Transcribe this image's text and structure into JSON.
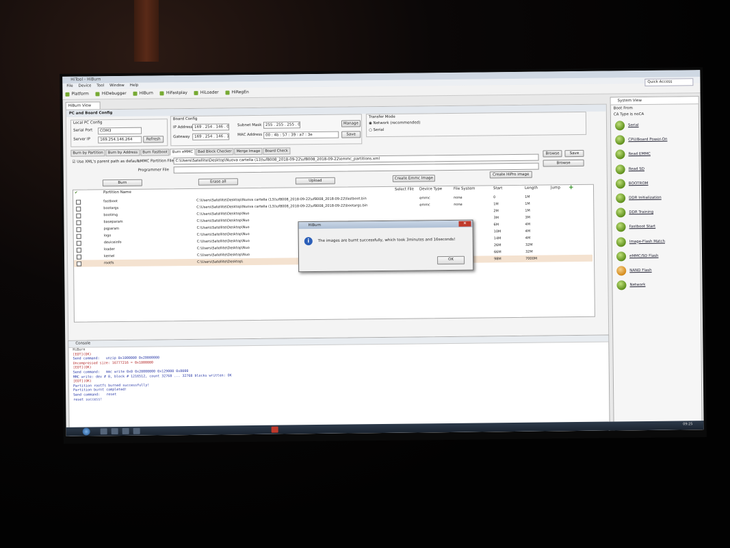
{
  "window": {
    "title": "HiTool - HiBurn"
  },
  "menu": [
    "File",
    "Device",
    "Tool",
    "Window",
    "Help"
  ],
  "toolbar": [
    "Platform",
    "HiDebugger",
    "HiBurn",
    "HiFastplay",
    "HiLoader",
    "HiRegEn"
  ],
  "quick_access": "Quick Access",
  "view_tab": "HiBurn View",
  "pc_board": {
    "section": "PC and Board Config",
    "local_pc": "Local PC Config",
    "serial_port_label": "Serial Port",
    "serial_port_value": "COM3",
    "server_ip_label": "Server IP",
    "server_ip_value": "169.254.146.264",
    "refresh": "Refresh",
    "board_config": "Board Config",
    "ip_label": "IP Address",
    "ip_value": "169 . 254 . 146 . 0",
    "gateway_label": "Gateway",
    "gateway_value": "169 . 254 . 146 . 1",
    "subnet_label": "Subnet Mask",
    "subnet_value": "255 . 255 . 255 . 0",
    "mac_label": "MAC Address",
    "mac_value": "00 : 4b : 57 : 39 : a7 : 3e",
    "manage": "Manage",
    "save": "Save",
    "transfer_mode": "Transfer Mode",
    "network": "Network (recommended)",
    "serial": "Serial"
  },
  "tabs": [
    "Burn by Partition",
    "Burn by Address",
    "Burn Fastboot",
    "Burn eMMC",
    "Bad Block Checker",
    "Merge Image",
    "Board Check"
  ],
  "burn": {
    "use_xml": "Use XML's parent path as default",
    "partition_file_label": "eMMC Partition File",
    "partition_file_value": "C:\\Users\\Satellite\\Desktop\\Nuova cartella (13)\\uf8008_2018-09-22\\uf8008_2018-09-22\\emmc_partitions.xml",
    "programmer_label": "Programmer File",
    "browse": "Browse",
    "save": "Save",
    "browse2": "Browse",
    "burn": "Burn",
    "erase": "Erase all",
    "upload": "Upload",
    "create_emmc": "Create Emmc Image",
    "create_hipro": "Create HiPro image"
  },
  "table": {
    "headers": [
      "Partition Name",
      "Select File",
      "Device Type",
      "File System",
      "Start",
      "Length",
      "Jump"
    ],
    "rows": [
      {
        "name": "fastboot",
        "file": "C:\\Users\\Satellite\\Desktop\\Nuova cartella (13)\\uf8008_2018-09-22\\uf8008_2018-09-22\\fastboot.bin",
        "dev": "emmc",
        "fs": "none",
        "start": "0",
        "len": "1M"
      },
      {
        "name": "bootargs",
        "file": "C:\\Users\\Satellite\\Desktop\\Nuova cartella (13)\\uf8008_2018-09-22\\uf8008_2018-09-22\\bootargs.bin",
        "dev": "emmc",
        "fs": "none",
        "start": "1M",
        "len": "1M"
      },
      {
        "name": "bootimg",
        "file": "C:\\Users\\Satellite\\Desktop\\Nuo",
        "dev": "",
        "fs": "",
        "start": "2M",
        "len": "1M"
      },
      {
        "name": "baseparam",
        "file": "C:\\Users\\Satellite\\Desktop\\Nuo",
        "dev": "",
        "fs": "",
        "start": "3M",
        "len": "3M"
      },
      {
        "name": "pqparam",
        "file": "C:\\Users\\Satellite\\Desktop\\Nuo",
        "dev": "",
        "fs": "",
        "start": "6M",
        "len": "4M"
      },
      {
        "name": "logo",
        "file": "C:\\Users\\Satellite\\Desktop\\Nuo",
        "dev": "",
        "fs": "",
        "start": "10M",
        "len": "4M"
      },
      {
        "name": "deviceinfo",
        "file": "C:\\Users\\Satellite\\Desktop\\Nuo",
        "dev": "",
        "fs": "",
        "start": "14M",
        "len": "4M"
      },
      {
        "name": "loader",
        "file": "C:\\Users\\Satellite\\Desktop\\Nuo",
        "dev": "",
        "fs": "",
        "start": "26M",
        "len": "32M"
      },
      {
        "name": "kernel",
        "file": "C:\\Users\\Satellite\\Desktop\\Nuo",
        "dev": "",
        "fs": "",
        "start": "66M",
        "len": "32M"
      },
      {
        "name": "rootfs",
        "file": "C:\\Users\\Satellite\\Desktop\\",
        "dev": "",
        "fs": "",
        "start": "98M",
        "len": "7000M"
      }
    ]
  },
  "dialog": {
    "title": "HiBurn",
    "message": "The images are burnt successfully, which took 3minutes and 16seconds!",
    "ok": "OK"
  },
  "console": {
    "title": "Console",
    "sub": "HiBurn",
    "lines": [
      {
        "t": "[EOT](OK)",
        "c": "red"
      },
      {
        "t": "Send command:   unzip 0x1000000 0x20000000",
        "c": "blue"
      },
      {
        "t": "Uncompressed size: 16777216 = 0x1000000",
        "c": "red"
      },
      {
        "t": "[EOT](OK)",
        "c": "red"
      },
      {
        "t": "",
        "c": "dark"
      },
      {
        "t": "Send command:   mmc write 0x0 0x20000000 0x129000 0x8000",
        "c": "blue"
      },
      {
        "t": "",
        "c": "dark"
      },
      {
        "t": "MMC write: dev # 0, block # 1216512, count 32768 ... 32768 blocks written: OK",
        "c": "blue"
      },
      {
        "t": "[EOT](OK)",
        "c": "red"
      },
      {
        "t": "Partition rootfs burned successfully!",
        "c": "blue"
      },
      {
        "t": "Partition burnt completed!",
        "c": "blue"
      },
      {
        "t": "",
        "c": "dark"
      },
      {
        "t": "Send command:   reset",
        "c": "blue"
      },
      {
        "t": "reset success!",
        "c": "blue"
      }
    ]
  },
  "system_view": {
    "title": "System View",
    "boot_from": "Boot From",
    "ca_type": "CA Type is  noCA",
    "steps": [
      {
        "label": "Serial",
        "color": "green"
      },
      {
        "label": "CPU/Board Power-On",
        "color": "green"
      },
      {
        "label": "Read EMMC",
        "color": "green"
      },
      {
        "label": "Read SD",
        "color": "green"
      },
      {
        "label": "BOOTROM",
        "color": "green"
      },
      {
        "label": "DDR Initialization",
        "color": "green"
      },
      {
        "label": "DDR Training",
        "color": "green"
      },
      {
        "label": "Fastboot Start",
        "color": "green"
      },
      {
        "label": "Image-Flash Match",
        "color": "green"
      },
      {
        "label": "eMMC/SD Flash",
        "color": "green"
      },
      {
        "label": "NAND Flash",
        "color": "orange"
      },
      {
        "label": "Network",
        "color": "green"
      }
    ]
  },
  "taskbar": {
    "clock": "09:25"
  }
}
